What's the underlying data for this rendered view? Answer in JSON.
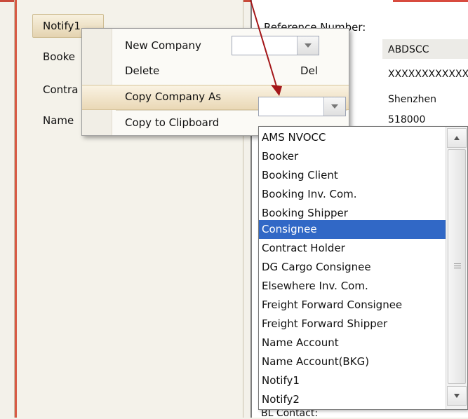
{
  "left_tree": {
    "items": [
      "Notify1",
      "Booke",
      "Contra",
      "Name"
    ]
  },
  "right_panel": {
    "labels": {
      "reference": "Reference Number:",
      "company_code": "ABDSCC",
      "code_value": "XXXXXXXXXXXX",
      "city": "Shenzhen",
      "postal": "518000",
      "bl_contact": "BL Contact:"
    }
  },
  "context_menu": {
    "items": [
      {
        "label": "New Company",
        "shortcut": ""
      },
      {
        "label": "Delete",
        "shortcut": "Del"
      },
      {
        "label": "Copy Company As",
        "shortcut": ""
      },
      {
        "label": "Copy to Clipboard",
        "shortcut": ""
      }
    ]
  },
  "dropdown": {
    "options": [
      "AMS NVOCC",
      "Booker",
      "Booking Client",
      "Booking Inv. Com.",
      "Booking Shipper",
      "Consignee",
      "Contract Holder",
      "DG Cargo Consignee",
      "Elsewhere Inv. Com.",
      "Freight Forward Consignee",
      "Freight Forward Shipper",
      "Name Account",
      "Name Account(BKG)",
      "Notify1",
      "Notify2"
    ],
    "selected": "Consignee"
  },
  "colors": {
    "selection": "#3168c6",
    "menu_highlight": "#ead8b6",
    "annotation_arrow": "#a4171a"
  },
  "icons": {
    "combo_arrow": "chevron-down-icon",
    "scroll_up": "triangle-up-icon",
    "scroll_down": "triangle-down-icon"
  }
}
